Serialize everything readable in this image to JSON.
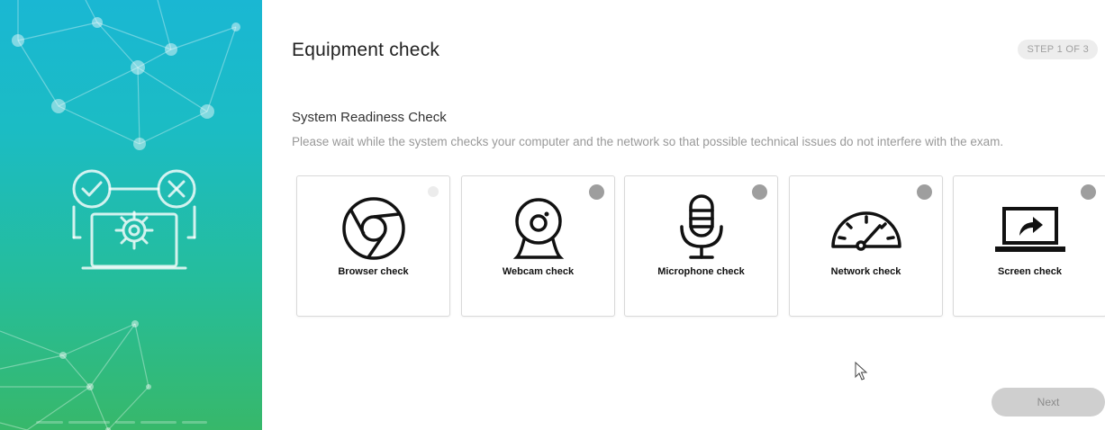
{
  "header": {
    "title": "Equipment check",
    "step": "STEP 1 OF 3"
  },
  "section": {
    "title": "System Readiness Check",
    "description": "Please wait while the system checks your computer and the network so that possible technical issues do not interfere with the exam."
  },
  "checks": [
    {
      "label": "Browser check",
      "icon": "browser-icon",
      "status": "done"
    },
    {
      "label": "Webcam check",
      "icon": "webcam-icon",
      "status": "pending"
    },
    {
      "label": "Microphone check",
      "icon": "microphone-icon",
      "status": "pending"
    },
    {
      "label": "Network check",
      "icon": "network-icon",
      "status": "pending"
    },
    {
      "label": "Screen check",
      "icon": "screen-icon",
      "status": "pending"
    }
  ],
  "footer": {
    "next_label": "Next"
  },
  "colors": {
    "sidebar_top": "#1ab7d3",
    "sidebar_bottom": "#37b86a",
    "pending_dot": "#9e9e9e",
    "next_button": "#cfcfcf"
  }
}
